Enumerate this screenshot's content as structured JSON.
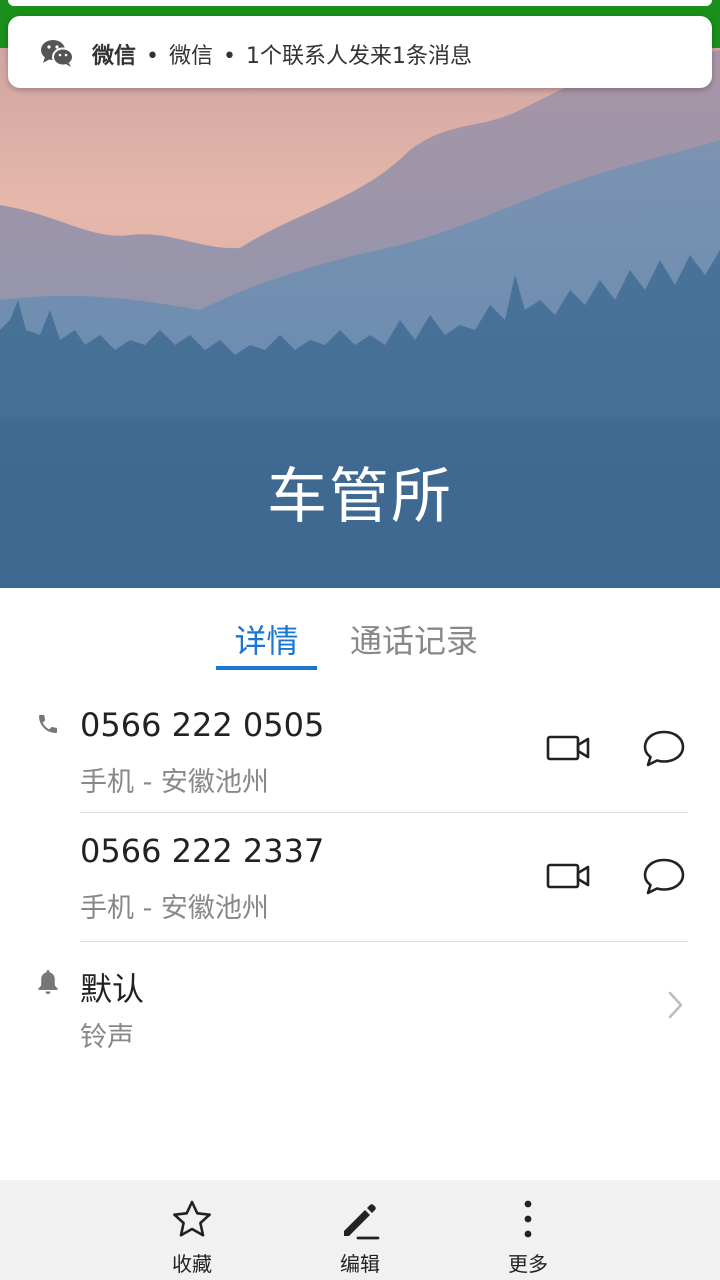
{
  "notification": {
    "app_name": "微信",
    "separator": "•",
    "title": "微信",
    "message": "1个联系人发来1条消息"
  },
  "contact": {
    "name": "车管所"
  },
  "tabs": [
    {
      "label": "详情",
      "selected": true
    },
    {
      "label": "通话记录",
      "selected": false
    }
  ],
  "phones": [
    {
      "number": "0566 222 0505",
      "label": "手机 - 安徽池州"
    },
    {
      "number": "0566 222 2337",
      "label": "手机 - 安徽池州"
    }
  ],
  "ringtone": {
    "value": "默认",
    "label": "铃声"
  },
  "bottom_bar": [
    {
      "label": "收藏",
      "icon": "star-icon"
    },
    {
      "label": "编辑",
      "icon": "pencil-icon"
    },
    {
      "label": "更多",
      "icon": "more-vertical-icon"
    }
  ],
  "colors": {
    "accent": "#1976d2",
    "status_bar": "#1a8f1a",
    "hero_sky": "#e2b2a6",
    "hero_forest": "#3f6a90"
  }
}
